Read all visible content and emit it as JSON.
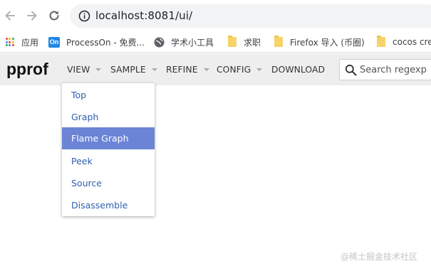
{
  "browser": {
    "url": "localhost:8081/ui/",
    "bookmarks": [
      {
        "label": "应用",
        "icon": "apps-grid-icon"
      },
      {
        "label": "ProcessOn - 免费...",
        "icon": "processon-icon"
      },
      {
        "label": "学术小工具",
        "icon": "globe-icon"
      },
      {
        "label": "求职",
        "icon": "folder-icon"
      },
      {
        "label": "Firefox 导入 (币圈)",
        "icon": "folder-icon"
      },
      {
        "label": "cocos crea",
        "icon": "folder-icon"
      }
    ],
    "processon_badge": "On"
  },
  "app": {
    "brand": "pprof",
    "menus": [
      "VIEW",
      "SAMPLE",
      "REFINE",
      "CONFIG",
      "DOWNLOAD"
    ],
    "search_placeholder": "Search regexp",
    "view_menu_items": [
      "Top",
      "Graph",
      "Flame Graph",
      "Peek",
      "Source",
      "Disassemble"
    ],
    "active_item": "Flame Graph"
  },
  "watermark": "@稀土掘金技术社区",
  "colors": {
    "toolbar_bg": "#eeeeee",
    "active_item_bg": "#6b84d6",
    "menu_link": "#2f5fae"
  }
}
